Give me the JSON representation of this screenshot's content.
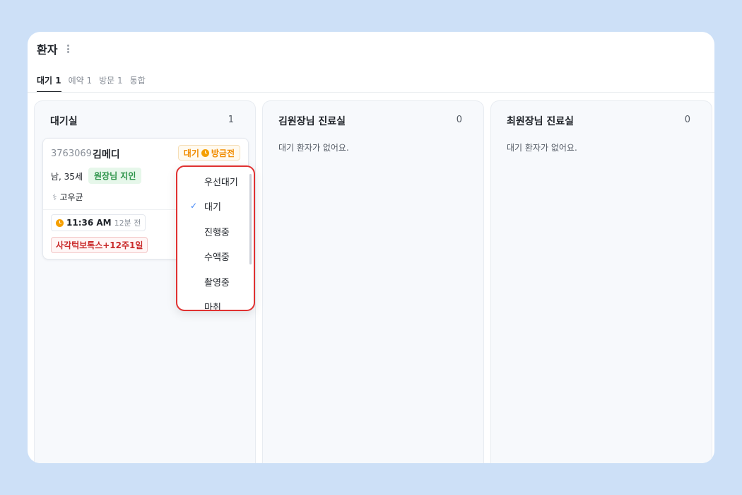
{
  "header": {
    "title": "환자"
  },
  "tabs": [
    {
      "label": "대기 1",
      "active": true
    },
    {
      "label": "예약 1",
      "active": false
    },
    {
      "label": "방문 1",
      "active": false
    },
    {
      "label": "통합",
      "active": false
    }
  ],
  "columns": [
    {
      "title": "대기실",
      "count": "1",
      "empty_text": ""
    },
    {
      "title": "김원장님 진료실",
      "count": "0",
      "empty_text": "대기 환자가 없어요."
    },
    {
      "title": "최원장님 진료실",
      "count": "0",
      "empty_text": "대기 환자가 없어요."
    }
  ],
  "patient_card": {
    "id": "3763069",
    "name": "김메디",
    "status": "대기",
    "sub_status": "방금전",
    "gender_age": "남, 35세",
    "tag": "원장님 지인",
    "doctor": "고우균",
    "time": "11:36 AM",
    "time_ago": "12분 전",
    "treatment": "사각턱보톡스+12주1일"
  },
  "status_dropdown": {
    "options": [
      "우선대기",
      "대기",
      "진행중",
      "수액중",
      "촬영중",
      "마취"
    ],
    "selected": "대기"
  },
  "colors": {
    "background": "#cde0f7",
    "status_orange": "#f08c00",
    "tag_green": "#2b9348",
    "treatment_red": "#c92a2a",
    "highlight_red": "#e03131",
    "check_blue": "#3b82f6"
  },
  "icons": [
    "kebab-menu-icon",
    "clock-icon",
    "stethoscope-icon",
    "check-icon"
  ]
}
